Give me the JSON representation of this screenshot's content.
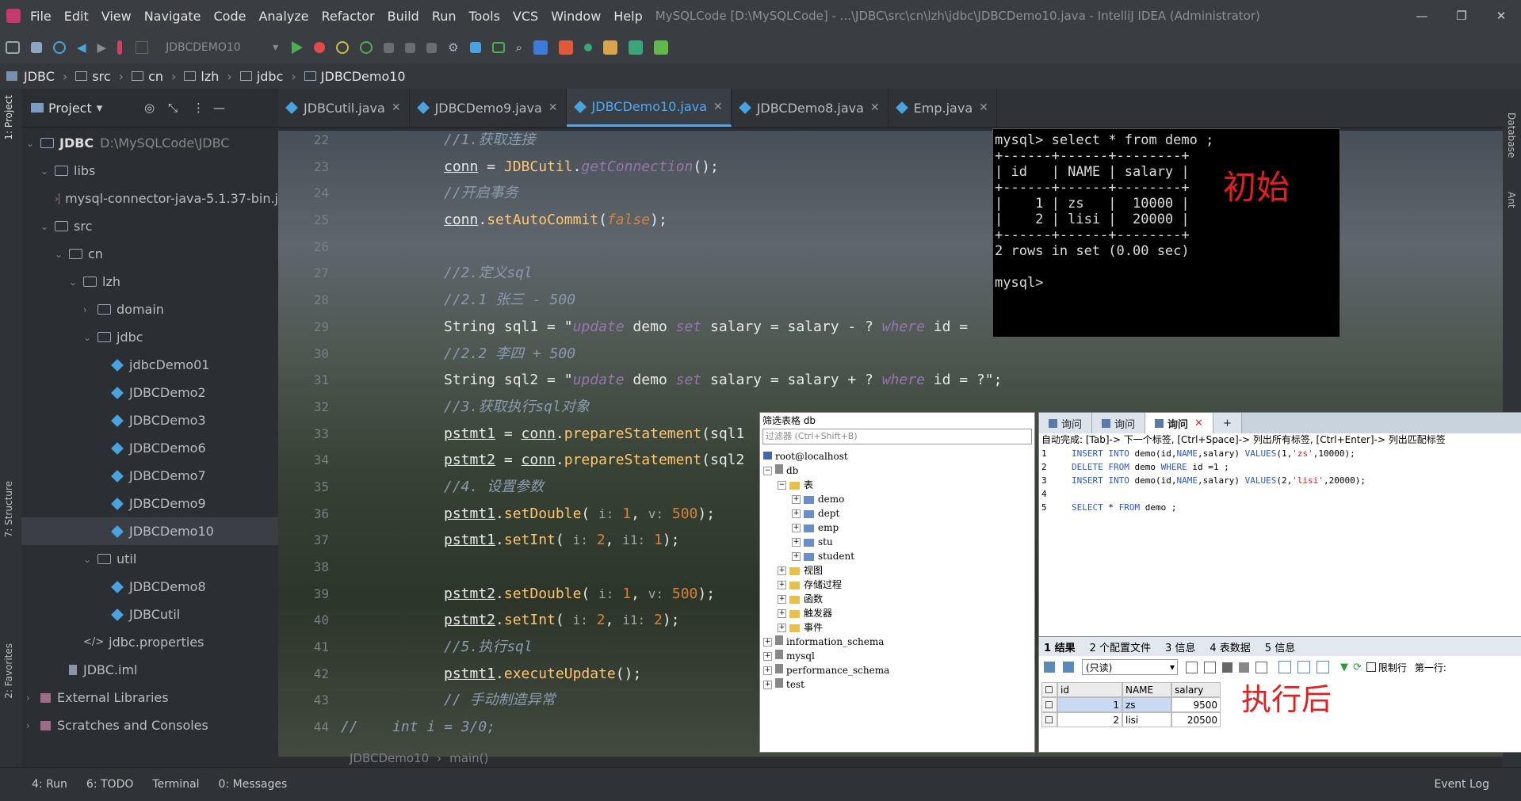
{
  "window": {
    "title": "MySQLCode [D:\\MySQLCode] - ...\\JDBC\\src\\cn\\lzh\\jdbc\\JDBCDemo10.java - IntelliJ IDEA (Administrator)",
    "menus": [
      "File",
      "Edit",
      "View",
      "Navigate",
      "Code",
      "Analyze",
      "Refactor",
      "Build",
      "Run",
      "Tools",
      "VCS",
      "Window",
      "Help"
    ],
    "controls": {
      "minimize": "—",
      "maximize": "❐",
      "close": "✕"
    }
  },
  "toolbar": {
    "run_config": "JDBCDEMO10"
  },
  "breadcrumbs": [
    "JDBC",
    "src",
    "cn",
    "lzh",
    "jdbc",
    "JDBCDemo10"
  ],
  "sidebar_left": {
    "project_tab": "1: Project",
    "structure_tab": "7: Structure",
    "favorites_tab": "2: Favorites"
  },
  "sidebar_right": {
    "database_tab": "Database",
    "ant_tab": "Ant"
  },
  "project": {
    "header": "Project",
    "items": [
      {
        "label": "JDBC",
        "extra": "D:\\MySQLCode\\JDBC",
        "indent": 0,
        "kind": "module"
      },
      {
        "label": "libs",
        "indent": 1,
        "kind": "folder"
      },
      {
        "label": "mysql-connector-java-5.1.37-bin.j",
        "indent": 2,
        "kind": "jar"
      },
      {
        "label": "src",
        "indent": 1,
        "kind": "folder"
      },
      {
        "label": "cn",
        "indent": 2,
        "kind": "folder"
      },
      {
        "label": "lzh",
        "indent": 3,
        "kind": "folder"
      },
      {
        "label": "domain",
        "indent": 4,
        "kind": "folder"
      },
      {
        "label": "jdbc",
        "indent": 4,
        "kind": "folder"
      },
      {
        "label": "jdbcDemo01",
        "indent": 5,
        "kind": "java"
      },
      {
        "label": "JDBCDemo2",
        "indent": 5,
        "kind": "java"
      },
      {
        "label": "JDBCDemo3",
        "indent": 5,
        "kind": "java"
      },
      {
        "label": "JDBCDemo6",
        "indent": 5,
        "kind": "java"
      },
      {
        "label": "JDBCDemo7",
        "indent": 5,
        "kind": "java"
      },
      {
        "label": "JDBCDemo9",
        "indent": 5,
        "kind": "java"
      },
      {
        "label": "JDBCDemo10",
        "indent": 5,
        "kind": "java"
      },
      {
        "label": "util",
        "indent": 4,
        "kind": "folder"
      },
      {
        "label": "JDBCDemo8",
        "indent": 5,
        "kind": "java"
      },
      {
        "label": "JDBCutil",
        "indent": 5,
        "kind": "java"
      },
      {
        "label": "jdbc.properties",
        "indent": 3,
        "kind": "props"
      },
      {
        "label": "JDBC.iml",
        "indent": 2,
        "kind": "iml"
      },
      {
        "label": "External Libraries",
        "indent": 0,
        "kind": "lib"
      },
      {
        "label": "Scratches and Consoles",
        "indent": 0,
        "kind": "lib"
      }
    ]
  },
  "tabs": [
    {
      "label": "JDBCutil.java",
      "active": false
    },
    {
      "label": "JDBCDemo9.java",
      "active": false
    },
    {
      "label": "JDBCDemo10.java",
      "active": true
    },
    {
      "label": "JDBCDemo8.java",
      "active": false
    },
    {
      "label": "Emp.java",
      "active": false
    }
  ],
  "code": {
    "line_numbers": [
      "22",
      "23",
      "24",
      "25",
      "26",
      "27",
      "28",
      "29",
      "30",
      "31",
      "32",
      "33",
      "34",
      "35",
      "36",
      "37",
      "38",
      "39",
      "40",
      "41",
      "42",
      "43",
      "44"
    ]
  },
  "navbar": {
    "file": "JDBCDemo10",
    "method": "main()"
  },
  "mysql": {
    "lines": [
      "mysql> select * from demo ;",
      "+------+------+--------+",
      "| id   | NAME | salary |",
      "+------+------+--------+",
      "|    1 | zs   |  10000 |",
      "|    2 | lisi |  20000 |",
      "+------+------+--------+",
      "2 rows in set (0.00 sec)",
      "",
      "mysql>"
    ],
    "label": "初始"
  },
  "dbtree": {
    "title": "筛选表格 db",
    "filter": "过滤器 (Ctrl+Shift+B)",
    "host": "root@localhost",
    "db": "db",
    "tables_label": "表",
    "tables": [
      "demo",
      "dept",
      "emp",
      "stu",
      "student"
    ],
    "folders": [
      "视图",
      "存储过程",
      "函数",
      "触发器",
      "事件"
    ],
    "other_dbs": [
      "information_schema",
      "mysql",
      "performance_schema",
      "test"
    ]
  },
  "query": {
    "tabs": [
      "询问",
      "询问",
      "询问"
    ],
    "hint": "自动完成: [Tab]-> 下一个标签, [Ctrl+Space]-> 列出所有标签, [Ctrl+Enter]-> 列出匹配标签",
    "lines": [
      {
        "n": "1",
        "text": "INSERT INTO demo(id,NAME,salary) VALUES(1,'zs',10000);"
      },
      {
        "n": "2",
        "text": "DELETE FROM demo WHERE id =1 ;"
      },
      {
        "n": "3",
        "text": "INSERT INTO demo(id,NAME,salary) VALUES(2,'lisi',20000);"
      },
      {
        "n": "4",
        "text": ""
      },
      {
        "n": "5",
        "text": "SELECT * FROM demo ;"
      }
    ]
  },
  "result": {
    "tabs": [
      "1 结果",
      "2 个配置文件",
      "3 信息",
      "4 表数据",
      "5 信息"
    ],
    "readonly": "(只读)",
    "limit": "限制行",
    "first_row": "第一行:",
    "headers": [
      "id",
      "NAME",
      "salary"
    ],
    "rows": [
      [
        "1",
        "zs",
        "9500"
      ],
      [
        "2",
        "lisi",
        "20500"
      ]
    ],
    "label": "执行后"
  },
  "statusbar": {
    "items": [
      "4: Run",
      "6: TODO",
      "Terminal",
      "0: Messages"
    ],
    "event_log": "Event Log"
  }
}
